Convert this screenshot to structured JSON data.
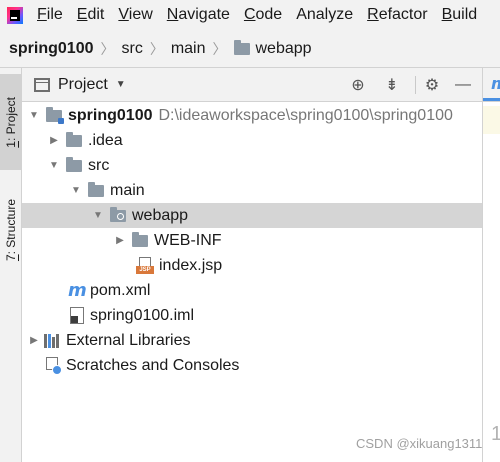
{
  "menubar": {
    "items": [
      {
        "label": "File",
        "mnemonic": "F",
        "rest": "ile"
      },
      {
        "label": "Edit",
        "mnemonic": "E",
        "rest": "dit"
      },
      {
        "label": "View",
        "mnemonic": "V",
        "rest": "iew"
      },
      {
        "label": "Navigate",
        "mnemonic": "N",
        "rest": "avigate"
      },
      {
        "label": "Code",
        "mnemonic": "C",
        "rest": "ode"
      },
      {
        "label": "Analyze",
        "mnemonic": "",
        "rest": "Analyze"
      },
      {
        "label": "Refactor",
        "mnemonic": "R",
        "rest": "efactor"
      },
      {
        "label": "Build",
        "mnemonic": "B",
        "rest": "uild"
      }
    ]
  },
  "breadcrumb": {
    "items": [
      "spring0100",
      "src",
      "main",
      "webapp"
    ]
  },
  "tool_strip": {
    "project_tab": {
      "mnemonic": "1",
      "label": ": Project"
    },
    "structure_tab": {
      "mnemonic": "7",
      "label": ": Structure"
    }
  },
  "panel": {
    "title": "Project",
    "icons": [
      "locate-icon",
      "collapse-all-icon",
      "gear-icon",
      "minimize-icon"
    ]
  },
  "tree": {
    "root": {
      "name": "spring0100",
      "path": "D:\\ideaworkspace\\spring0100\\spring0100"
    },
    "idea": ".idea",
    "src": "src",
    "main": "main",
    "webapp": "webapp",
    "webinf": "WEB-INF",
    "indexjsp": "index.jsp",
    "pom": "pom.xml",
    "iml": "spring0100.iml",
    "ext_libs": "External Libraries",
    "scratches": "Scratches and Consoles"
  },
  "editor": {
    "tab_icon": "m",
    "line_number": "1"
  },
  "watermark": "CSDN @xikuang1311"
}
